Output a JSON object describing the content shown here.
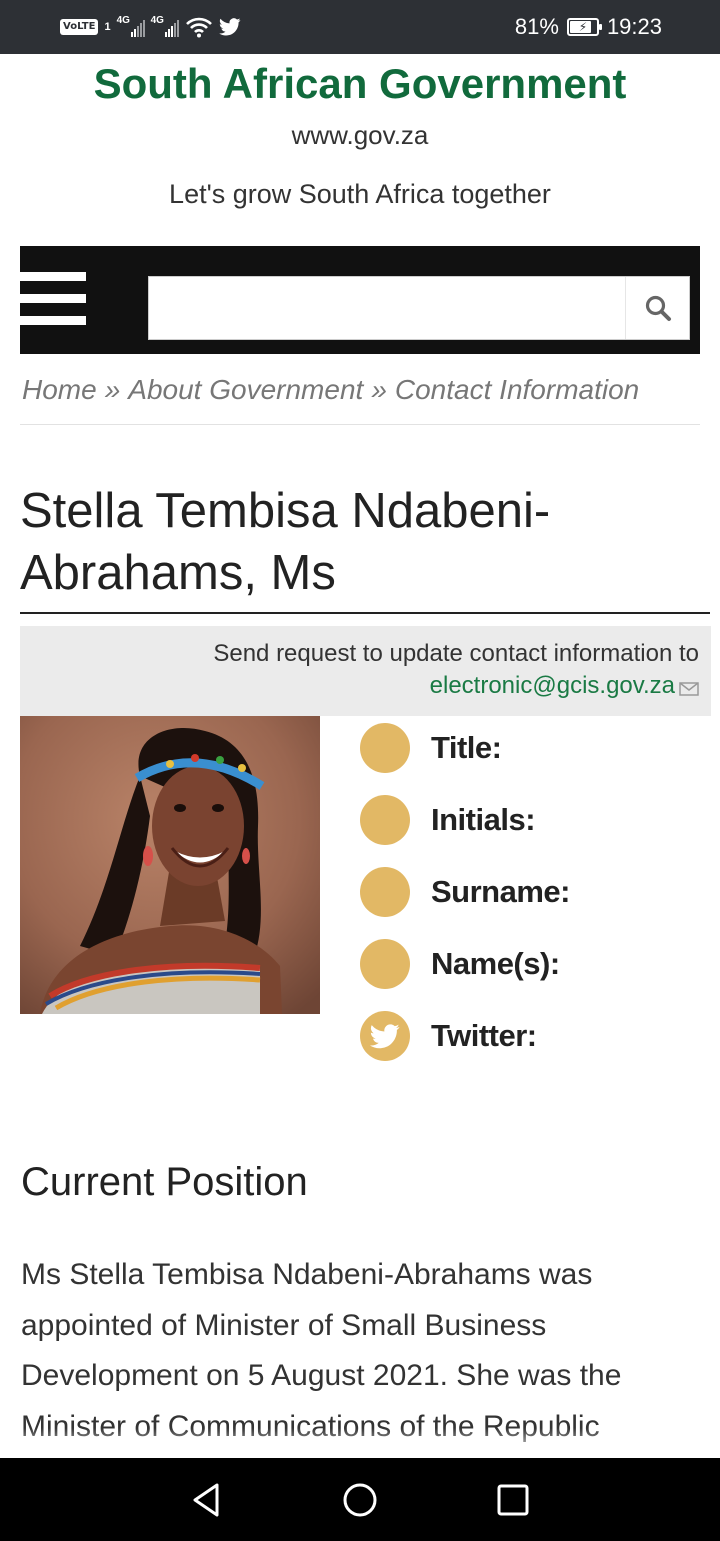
{
  "status_bar": {
    "volte": "VoLTE",
    "sim": "1",
    "network_1": "4G",
    "network_2": "4G",
    "battery": "81%",
    "battery_level": 0.81,
    "time": "19:23"
  },
  "header": {
    "site_title": "South African Government",
    "site_url": "www.gov.za",
    "tagline": "Let's grow South Africa together"
  },
  "search": {
    "value": "",
    "placeholder": ""
  },
  "breadcrumb": {
    "items": [
      "Home",
      "About Government",
      "Contact Information"
    ],
    "separator": "»"
  },
  "page": {
    "title": "Stella Tembisa Ndabeni-Abrahams, Ms",
    "update_notice": "Send request to update contact information to",
    "update_email": "electronic@gcis.gov.za"
  },
  "contact_fields": [
    {
      "label": "Title:",
      "icon": "circle-icon"
    },
    {
      "label": "Initials:",
      "icon": "circle-icon"
    },
    {
      "label": "Surname:",
      "icon": "circle-icon"
    },
    {
      "label": "Name(s):",
      "icon": "circle-icon"
    },
    {
      "label": "Twitter:",
      "icon": "twitter-icon"
    }
  ],
  "current_position": {
    "heading": "Current Position",
    "text": "Ms Stella Tembisa Ndabeni-Abrahams was appointed of Minister of Small Business Development on 5 August 2021. She was the Minister of Communications of the Republic"
  },
  "colors": {
    "brand_green": "#116a3c",
    "link_green": "#1a7a44",
    "icon_gold": "#e2b865",
    "nav_black": "#111111"
  }
}
